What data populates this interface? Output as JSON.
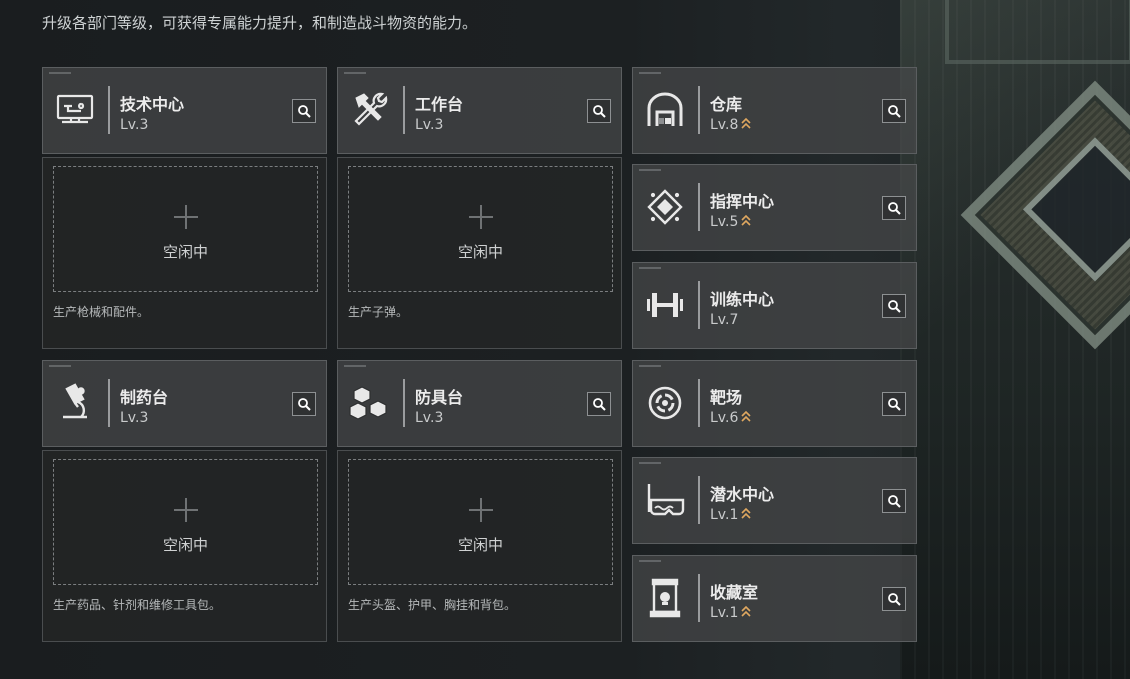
{
  "subtitle": "升级各部门等级，可获得专属能力提升，和制造战斗物资的能力。",
  "idle_label": "空闲中",
  "production_departments": [
    {
      "name": "技术中心",
      "level": "Lv.3",
      "icon": "computer-icon",
      "description": "生产枪械和配件。"
    },
    {
      "name": "工作台",
      "level": "Lv.3",
      "icon": "hammer-wrench-icon",
      "description": "生产子弹。"
    },
    {
      "name": "制药台",
      "level": "Lv.3",
      "icon": "microscope-icon",
      "description": "生产药品、针剂和维修工具包。"
    },
    {
      "name": "防具台",
      "level": "Lv.3",
      "icon": "armor-boxes-icon",
      "description": "生产头盔、护甲、胸挂和背包。"
    }
  ],
  "side_departments": [
    {
      "name": "仓库",
      "level": "Lv.8",
      "icon": "warehouse-icon",
      "upgradable": true
    },
    {
      "name": "指挥中心",
      "level": "Lv.5",
      "icon": "command-diamond-icon",
      "upgradable": true
    },
    {
      "name": "训练中心",
      "level": "Lv.7",
      "icon": "dumbbell-icon",
      "upgradable": false
    },
    {
      "name": "靶场",
      "level": "Lv.6",
      "icon": "target-icon",
      "upgradable": true
    },
    {
      "name": "潜水中心",
      "level": "Lv.1",
      "icon": "diving-mask-icon",
      "upgradable": true
    },
    {
      "name": "收藏室",
      "level": "Lv.1",
      "icon": "display-case-icon",
      "upgradable": true
    }
  ],
  "colors": {
    "upgrade_arrow": "#e0a860",
    "card_bg": "#46484a",
    "panel_bg": "#232526"
  }
}
